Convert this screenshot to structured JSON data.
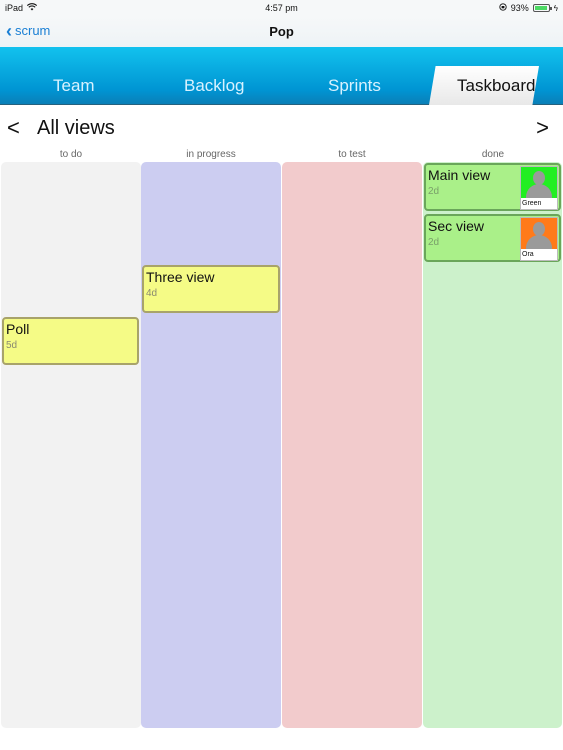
{
  "status_bar": {
    "device": "iPad",
    "wifi_icon": "wifi-icon",
    "time": "4:57 pm",
    "lock_icon": "orientation-lock-icon",
    "battery": "93%",
    "battery_level": 0.93
  },
  "nav": {
    "back_label": "scrum",
    "title": "Pop"
  },
  "tabs": [
    {
      "label": "Team",
      "active": false
    },
    {
      "label": "Backlog",
      "active": false
    },
    {
      "label": "Sprints",
      "active": false
    },
    {
      "label": "Taskboard",
      "active": true
    }
  ],
  "view": {
    "prev": "<",
    "title": "All views",
    "next": ">"
  },
  "columns": [
    {
      "label": "to do",
      "color": "#f2f2f2"
    },
    {
      "label": "in progress",
      "color": "#cccdf1"
    },
    {
      "label": "to test",
      "color": "#f2cbcc"
    },
    {
      "label": "done",
      "color": "#ccf1cb"
    }
  ],
  "cards": [
    {
      "column": "to do",
      "name": "Poll",
      "estimate": "5d"
    },
    {
      "column": "in progress",
      "name": "Three view",
      "estimate": "4d"
    },
    {
      "column": "done",
      "name": "Main view",
      "estimate": "2d",
      "assignee": "Green",
      "avatar_color": "#22ee22"
    },
    {
      "column": "done",
      "name": "Sec view",
      "estimate": "2d",
      "assignee": "Ora",
      "avatar_color": "#ff7a1a"
    }
  ]
}
